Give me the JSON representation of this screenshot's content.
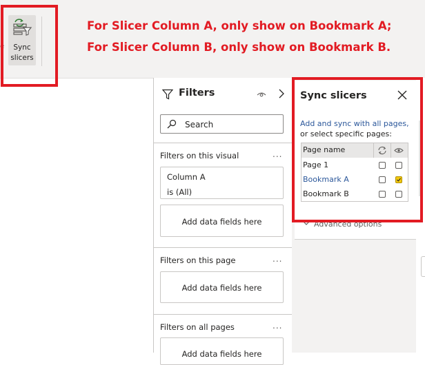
{
  "ribbon": {
    "edge_text": "e",
    "sync_button_label": "Sync\nslicers",
    "sync_icon": "sync-slicers-icon"
  },
  "callout": {
    "line1": "For Slicer Column A, only show on Bookmark A;",
    "line2": "For Slicer Column B, only show on Bookmark B.",
    "color": "#e21b23"
  },
  "filters": {
    "title": "Filters",
    "search_placeholder": "Search",
    "sections": [
      {
        "label": "Filters on this visual",
        "more": "...",
        "card": {
          "field": "Column A",
          "value": "is (All)"
        },
        "add_label": "Add data fields here"
      },
      {
        "label": "Filters on this page",
        "more": "...",
        "add_label": "Add data fields here"
      },
      {
        "label": "Filters on all pages",
        "more": "...",
        "add_label": "Add data fields here"
      }
    ]
  },
  "sync": {
    "title": "Sync slicers",
    "link": "Add and sync with all pages,",
    "sub": "or select specific pages:",
    "table": {
      "header": "Page name",
      "rows": [
        {
          "name": "Page 1",
          "sync": false,
          "visible": false
        },
        {
          "name": "Bookmark A",
          "sync": false,
          "visible": true
        },
        {
          "name": "Bookmark B",
          "sync": false,
          "visible": false
        }
      ]
    },
    "advanced": "Advanced options",
    "accent": "#f2c80f",
    "link_color": "#2b579a"
  }
}
